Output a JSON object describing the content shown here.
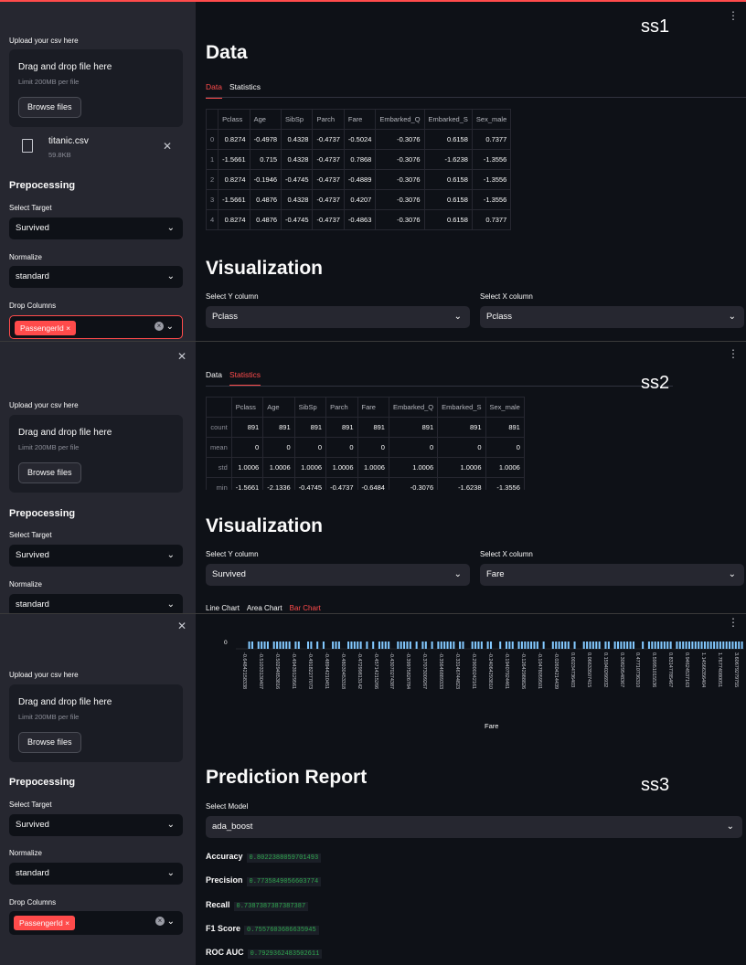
{
  "sidebar": {
    "upload_label": "Upload your csv here",
    "drop_title": "Drag and drop file here",
    "limit": "Limit 200MB per file",
    "browse_label": "Browse files",
    "file": {
      "name": "titanic.csv",
      "size": "59.8KB"
    },
    "prep_title": "Prepocessing",
    "target_label": "Select Target",
    "target_value": "Survived",
    "normalize_label": "Normalize",
    "normalize_value": "standard",
    "drop_label": "Drop Columns",
    "drop_tag": "PassengerId"
  },
  "main": {
    "data_title": "Data",
    "tab_data": "Data",
    "tab_statistics": "Statistics",
    "viz_title": "Visualization",
    "y_label": "Select Y column",
    "x_label": "Select X column",
    "chart_tabs": [
      "Line Chart",
      "Area Chart",
      "Bar Chart"
    ],
    "x_axis_title": "Fare",
    "y_zero": "0",
    "pred_title": "Prediction Report",
    "model_label": "Select Model",
    "model_value": "ada_boost"
  },
  "ss1": {
    "label": "ss1",
    "y_value": "Pclass",
    "x_value": "Pclass"
  },
  "ss2": {
    "label": "ss2",
    "y_value": "Survived",
    "x_value": "Fare"
  },
  "ss3": {
    "label": "ss3"
  },
  "data_table": {
    "columns": [
      "",
      "Pclass",
      "Age",
      "SibSp",
      "Parch",
      "Fare",
      "Embarked_Q",
      "Embarked_S",
      "Sex_male"
    ],
    "rows": [
      [
        "0",
        "0.8274",
        "-0.4978",
        "0.4328",
        "-0.4737",
        "-0.5024",
        "-0.3076",
        "0.6158",
        "0.7377"
      ],
      [
        "1",
        "-1.5661",
        "0.715",
        "0.4328",
        "-0.4737",
        "0.7868",
        "-0.3076",
        "-1.6238",
        "-1.3556"
      ],
      [
        "2",
        "0.8274",
        "-0.1946",
        "-0.4745",
        "-0.4737",
        "-0.4889",
        "-0.3076",
        "0.6158",
        "-1.3556"
      ],
      [
        "3",
        "-1.5661",
        "0.4876",
        "0.4328",
        "-0.4737",
        "0.4207",
        "-0.3076",
        "0.6158",
        "-1.3556"
      ],
      [
        "4",
        "0.8274",
        "0.4876",
        "-0.4745",
        "-0.4737",
        "-0.4863",
        "-0.3076",
        "0.6158",
        "0.7377"
      ]
    ]
  },
  "stats_table": {
    "columns": [
      "",
      "Pclass",
      "Age",
      "SibSp",
      "Parch",
      "Fare",
      "Embarked_Q",
      "Embarked_S",
      "Sex_male"
    ],
    "rows": [
      [
        "count",
        "891",
        "891",
        "891",
        "891",
        "891",
        "891",
        "891",
        "891"
      ],
      [
        "mean",
        "0",
        "0",
        "0",
        "0",
        "0",
        "0",
        "0",
        "0"
      ],
      [
        "std",
        "1.0006",
        "1.0006",
        "1.0006",
        "1.0006",
        "1.0006",
        "1.0006",
        "1.0006",
        "1.0006"
      ],
      [
        "min",
        "-1.5661",
        "-2.1336",
        "-0.4745",
        "-0.4737",
        "-0.6484",
        "-0.3076",
        "-1.6238",
        "-1.3556"
      ]
    ]
  },
  "metrics": [
    {
      "label": "Accuracy",
      "value": "0.8022388059701493"
    },
    {
      "label": "Precision",
      "value": "0.7735849056603774"
    },
    {
      "label": "Recall",
      "value": "0.7387387387387387"
    },
    {
      "label": "F1 Score",
      "value": "0.7557603686635945"
    },
    {
      "label": "ROC AUC",
      "value": "0.7929362483502611"
    }
  ],
  "chart_data": {
    "type": "bar",
    "xlabel": "Fare",
    "ylabel": "",
    "x_tick_labels": [
      "-0.64842158338",
      "-0.51033130407",
      "-0.50294853816",
      "-0.49439129561",
      "-0.49182277073",
      "-0.48944210451",
      "-0.48030453318",
      "-0.47299813142",
      "-0.45714215266",
      "-0.43070274387",
      "-0.39975826784",
      "-0.37073009267",
      "-0.35646889333",
      "-0.33146744823",
      "-0.29000242161",
      "-0.24064293810",
      "-0.19407924461",
      "-0.12642988826",
      "-0.10478059501",
      "-0.02604214439",
      "0.00234736403",
      "0.06633507415",
      "0.15940266932",
      "0.30829548367",
      "0.47710736310",
      "0.59951015536",
      "0.83147785467",
      "0.94624537163",
      "1.14566356404",
      "1.76774080051",
      "3.60679279755"
    ],
    "bar_presence": [
      0,
      0,
      0,
      0,
      1,
      1,
      0,
      1,
      1,
      1,
      1,
      0,
      1,
      1,
      1,
      1,
      1,
      1,
      0,
      1,
      1,
      0,
      0,
      1,
      1,
      0,
      1,
      0,
      1,
      0,
      0,
      1,
      1,
      1,
      0,
      0,
      1,
      1,
      1,
      1,
      1,
      0,
      1,
      0,
      1,
      0,
      1,
      1,
      1,
      1,
      0,
      0,
      1,
      1,
      1,
      1,
      1,
      0,
      1,
      0,
      1,
      1,
      0,
      1,
      0,
      1,
      1,
      1,
      1,
      1,
      1,
      0,
      1,
      1,
      0,
      0,
      1,
      1,
      1,
      1,
      0,
      1,
      1,
      0,
      0,
      1,
      0,
      1,
      1,
      1,
      0,
      1,
      1,
      1,
      1,
      1,
      1,
      1,
      0,
      1,
      0,
      0,
      1,
      1,
      1,
      1,
      1,
      1,
      0,
      1,
      0,
      0,
      1,
      1,
      1,
      1,
      1,
      1,
      0,
      1,
      1,
      0,
      1,
      1,
      1,
      1,
      1,
      1,
      1,
      0,
      0,
      1,
      0,
      1,
      1,
      1,
      1,
      1,
      1,
      1,
      1,
      0,
      1,
      1,
      1,
      1,
      1,
      1,
      1,
      1,
      1,
      1,
      1,
      1,
      1,
      1,
      1,
      1,
      1,
      1,
      1,
      1,
      1,
      1
    ]
  }
}
